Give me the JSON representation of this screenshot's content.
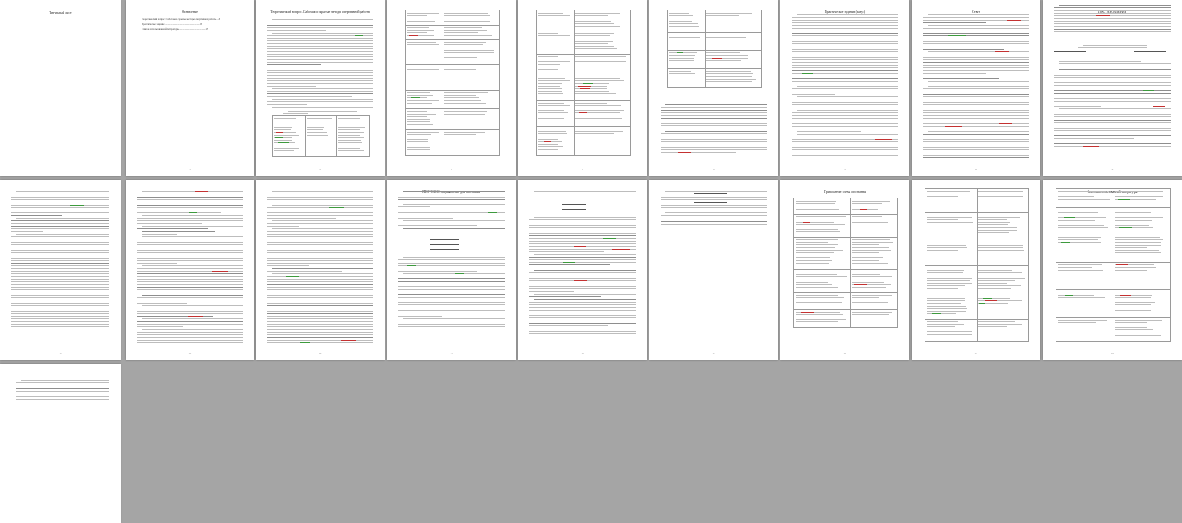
{
  "document": {
    "pages": [
      {
        "title": "Титульный лист",
        "toc_title": "",
        "toc": []
      },
      {
        "title": "Оглавление",
        "toc_title": "",
        "toc": [
          "Теоретический вопрос: Саботаж и скрытые методы оперативной работы ...3",
          "Практическое задание ...........................................................8",
          "Список использованной литературы ...........................................13"
        ]
      },
      {
        "title": "Теоретический вопрос. Саботаж и скрытые методы оперативной работы"
      },
      {
        "title": ""
      },
      {
        "title": ""
      },
      {
        "title": ""
      },
      {
        "title": "Практическое задание (казус)"
      },
      {
        "title": "Ответ"
      },
      {
        "title": "ПОСТАНОВЛЕНИЕ"
      },
      {
        "title": ""
      },
      {
        "title": ""
      },
      {
        "title": ""
      },
      {
        "title": "ПРОТОКОЛ предъявления для опознания"
      },
      {
        "title": ""
      },
      {
        "title": ""
      },
      {
        "title": "Приложение: схема опознания"
      },
      {
        "title": ""
      },
      {
        "title": "Список использованной литературы"
      }
    ],
    "page_numbers": [
      "",
      "2",
      "3",
      "4",
      "5",
      "6",
      "7",
      "8",
      "9",
      "10",
      "11",
      "12",
      "13",
      "14",
      "15",
      "16",
      "17",
      "18"
    ]
  }
}
